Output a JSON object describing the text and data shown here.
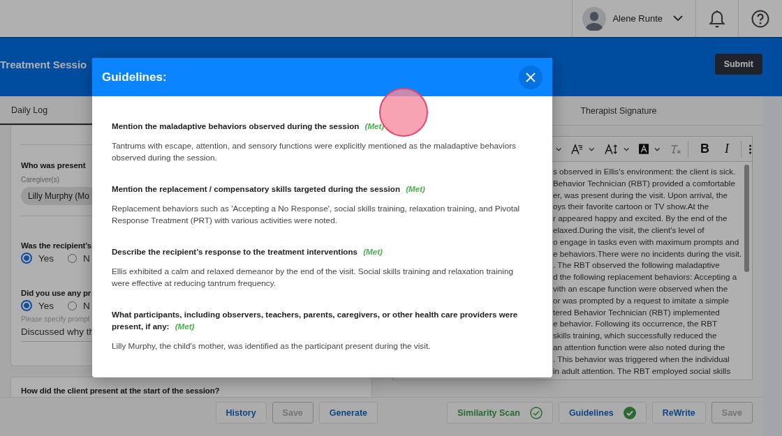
{
  "topbar": {
    "user": {
      "name": "Alene Runte"
    }
  },
  "header": {
    "title": "Treatment Sessio",
    "submit": "Submit"
  },
  "left_panel": {
    "tab": "Daily Log",
    "questions": [
      {
        "kind": "chips",
        "label": "Who was present",
        "sublabel": "Caregiver(s)",
        "chips": [
          "Lilly Murphy (Mo"
        ]
      },
      {
        "kind": "radio",
        "label": "Was the recipient’s",
        "options": [
          {
            "label": "Yes",
            "selected": true
          },
          {
            "label": "N",
            "selected": false
          }
        ]
      },
      {
        "kind": "radio",
        "label": "Did you use any pr",
        "options": [
          {
            "label": "Yes",
            "selected": true
          },
          {
            "label": "N",
            "selected": false
          }
        ],
        "detail": {
          "label": "Please specify prompt",
          "value": "Discussed why th"
        }
      }
    ],
    "next_question": "How did the client present at the start of the session?",
    "actions": [
      {
        "label": "History",
        "disabled": false
      },
      {
        "label": "Save",
        "disabled": true
      },
      {
        "label": "Generate",
        "disabled": false
      }
    ]
  },
  "right_panel": {
    "tab": "Therapist Signature",
    "toolbar": {
      "bold": "B",
      "italic": "I"
    },
    "editor_lines": [
      "s observed in Ellis's environment: the client is sick.",
      "Behavior Technician (RBT) provided a comfortable",
      "er, was present during the visit. Upon arrival, the",
      "oys their favorite cartoon or TV show.At the",
      "r appeared happy and excited. By the end of the",
      "elaxed.During the visit, the client's level of",
      "o engage in tasks even with maximum prompts and",
      "e behaviors.There were no incidents during the visit.",
      ". The RBT observed the following maladaptive",
      "d the following replacement behaviors: Accepting a",
      "vith an escape function were observed when the",
      "or was prompted by a request to imitate a simple",
      "tered Behavior Technician (RBT) implemented",
      "e behavior. Following its occurrence, the RBT",
      "skills training, which successfully reduced the",
      "an attention function were also noted during the",
      ". This behavior was triggered when the individual",
      "in adult attention. The RBT employed social skills"
    ],
    "actions": [
      {
        "label": "Similarity Scan",
        "kind": "scan",
        "checked": true,
        "disabled": false
      },
      {
        "label": "Guidelines",
        "kind": "guidelines",
        "checked": true,
        "disabled": false
      },
      {
        "label": "ReWrite",
        "kind": "plain",
        "disabled": false
      },
      {
        "label": "Save",
        "kind": "plain",
        "disabled": true
      }
    ]
  },
  "modal": {
    "title": "Guidelines:",
    "items": [
      {
        "title": "Mention the maladaptive behaviors observed during the session",
        "status": "(Met)",
        "text": "Tantrums with escape, attention, and sensory functions were explicitly mentioned as the maladaptive behaviors observed during the session."
      },
      {
        "title": "Mention the replacement / compensatory skills targeted during the session",
        "status": "(Met)",
        "text": "Replacement behaviors such as 'Accepting a No Response', social skills training, relaxation training, and Pivotal Response Treatment (PRT) with various activities were noted."
      },
      {
        "title": "Describe the recipient’s response to the treatment interventions",
        "status": "(Met)",
        "text": "Ellis exhibited a calm and relaxed demeanor by the end of the visit. Social skills training and relaxation training were effective at reducing tantrum frequency."
      },
      {
        "title": "What participants, including observers, teachers, parents, caregivers, or other health care providers were present, if any:",
        "status": "(Met)",
        "text": "Lilly Murphy, the child's mother, was identified as the participant present during the visit."
      }
    ]
  }
}
